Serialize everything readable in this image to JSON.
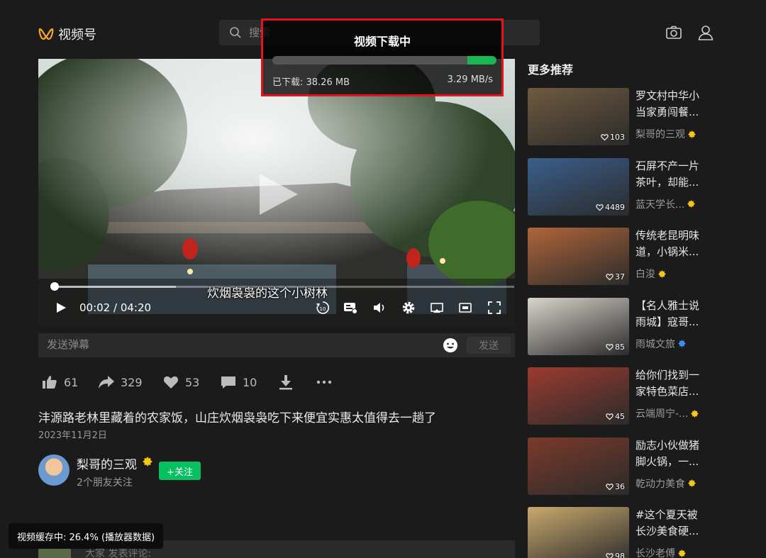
{
  "header": {
    "logo_text": "视频号",
    "search_placeholder": "搜索"
  },
  "player": {
    "subtitle": "炊烟袅袅的这个小树林",
    "time": "00:02 / 04:20",
    "played_fraction": 0.008,
    "buffered_fraction": 0.264
  },
  "danmaku": {
    "placeholder": "发送弹幕",
    "send_label": "发送"
  },
  "actions": {
    "like_count": "61",
    "share_count": "329",
    "favorite_count": "53",
    "comment_count": "10"
  },
  "video": {
    "title": "沣源路老林里藏着的农家饭，山庄炊烟袅袅吃下来便宜实惠太值得去一趟了",
    "date": "2023年11月2日"
  },
  "author": {
    "name": "梨哥的三观",
    "follow_label": "+关注",
    "friends_following": "2个朋友关注"
  },
  "comment": {
    "placeholder": "大家 发表评论:"
  },
  "cache_toast": "视频缓存中: 26.4% (播放器数据)",
  "download_popup": {
    "title": "视频下载中",
    "downloaded": "已下载: 38.26 MB",
    "speed": "3.29 MB/s",
    "progress_fraction": 0.13
  },
  "recommendations": {
    "title": "更多推荐",
    "items": [
      {
        "line1": "罗文村中华小",
        "line2": "当家勇闯餐...",
        "author": "梨哥的三观",
        "badge": "gold",
        "likes": "103",
        "thumb": "#6f5a3f"
      },
      {
        "line1": "石屏不产一片",
        "line2": "茶叶，却能...",
        "author": "蓝天学长...",
        "badge": "gold",
        "likes": "4489",
        "thumb": "#3a5f8d"
      },
      {
        "line1": "传统老昆明味",
        "line2": "道，小锅米...",
        "author": "白浚",
        "badge": "gold",
        "likes": "37",
        "thumb": "#b0653a"
      },
      {
        "line1": "【名人雅士说",
        "line2": "雨城】寇哥...",
        "author": "雨城文旅",
        "badge": "blue",
        "likes": "85",
        "thumb": "#d9d5cc"
      },
      {
        "line1": "给你们找到一",
        "line2": "家特色菜店...",
        "author": "云端周宁-...",
        "badge": "gold",
        "likes": "45",
        "thumb": "#9c3b2f"
      },
      {
        "line1": "励志小伙做猪",
        "line2": "脚火锅，一...",
        "author": "乾动力美食",
        "badge": "gold",
        "likes": "36",
        "thumb": "#7b3a2a"
      },
      {
        "line1": "#这个夏天被",
        "line2": "长沙美食硬...",
        "author": "长沙老傅",
        "badge": "gold",
        "likes": "98",
        "thumb": "#c9a96d"
      }
    ]
  },
  "colors": {
    "accent_green": "#07c160",
    "popup_border": "#e3141a",
    "background": "#1b1b1b"
  }
}
